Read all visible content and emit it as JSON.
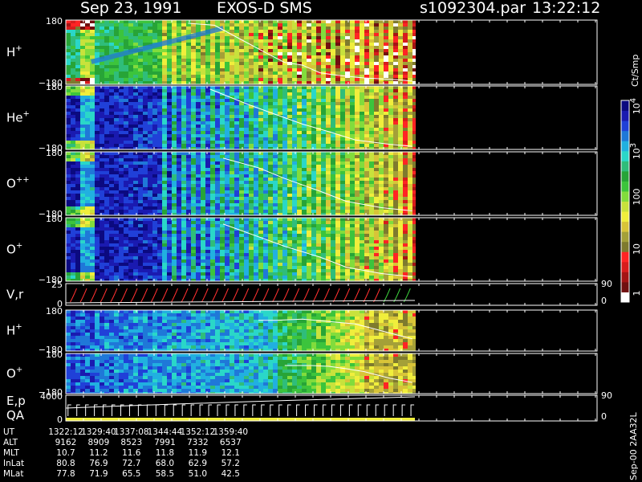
{
  "header": {
    "date": "Sep 23, 1991",
    "instrument": "EXOS-D SMS",
    "file": "s1092304.par",
    "time": "13:22:12"
  },
  "chart_data": {
    "type": "heatmap",
    "colorbar": {
      "title": "Ct/Smp",
      "labels": [
        "1",
        "10",
        "100",
        "10",
        "10"
      ],
      "label_sups": [
        "",
        "",
        "",
        "3",
        "4"
      ],
      "scale": "log",
      "range": [
        1,
        10000
      ],
      "colors": [
        "#0b0a80",
        "#1a1ab0",
        "#2040d8",
        "#1f78d8",
        "#21b0e0",
        "#2ad7c8",
        "#2fbd7a",
        "#27a437",
        "#3cc43c",
        "#82dc3c",
        "#c8e23c",
        "#f0ee3c",
        "#d8c438",
        "#a4a038",
        "#7e7a2e",
        "#ff2424",
        "#d81c1c",
        "#a41414",
        "#701010",
        "#ffffff"
      ]
    },
    "time_axis": {
      "range": [
        1322.2,
        1401.6
      ],
      "data_end": 1401.6
    },
    "panels": [
      {
        "id": "h-plus",
        "species": "H",
        "charge": "+",
        "ticks": [
          "180",
          "−180"
        ],
        "traj": [
          [
            1350,
            0.05
          ],
          [
            1356,
            0.08
          ],
          [
            1362,
            0.3
          ],
          [
            1368,
            0.52
          ],
          [
            1372,
            0.66
          ],
          [
            1376,
            0.7
          ],
          [
            1380,
            0.82
          ],
          [
            1384,
            0.86
          ],
          [
            1390,
            0.9
          ],
          [
            1398,
            0.93
          ],
          [
            1401,
            0.95
          ]
        ]
      },
      {
        "id": "he-plus",
        "species": "He",
        "charge": "+",
        "ticks": [
          "180",
          "−180"
        ],
        "traj": [
          [
            1355,
            0.05
          ],
          [
            1364,
            0.3
          ],
          [
            1370,
            0.45
          ],
          [
            1376,
            0.6
          ],
          [
            1382,
            0.72
          ],
          [
            1388,
            0.85
          ],
          [
            1396,
            0.92
          ],
          [
            1401,
            0.95
          ]
        ]
      },
      {
        "id": "o-plusplus",
        "species": "O",
        "charge": "++",
        "ticks": [
          "180",
          "−180"
        ],
        "traj": [
          [
            1358,
            0.1
          ],
          [
            1366,
            0.25
          ],
          [
            1372,
            0.42
          ],
          [
            1380,
            0.62
          ],
          [
            1386,
            0.78
          ],
          [
            1394,
            0.88
          ],
          [
            1401,
            0.93
          ]
        ]
      },
      {
        "id": "o-plus",
        "species": "O",
        "charge": "+",
        "ticks": [
          "180",
          "−180"
        ],
        "traj": [
          [
            1358,
            0.1
          ],
          [
            1366,
            0.3
          ],
          [
            1372,
            0.45
          ],
          [
            1380,
            0.62
          ],
          [
            1386,
            0.78
          ],
          [
            1394,
            0.88
          ],
          [
            1401,
            0.93
          ]
        ]
      },
      {
        "id": "vr",
        "species": "V,r",
        "charge": "",
        "ticks": [
          "25",
          "0"
        ],
        "right_ticks": [
          "90",
          "0"
        ]
      },
      {
        "id": "h-plus-2",
        "species": "H",
        "charge": "+",
        "ticks": [
          "180",
          "−180"
        ],
        "traj": [
          [
            1366,
            0.25
          ],
          [
            1370,
            0.25
          ],
          [
            1376,
            0.22
          ],
          [
            1380,
            0.26
          ],
          [
            1384,
            0.3
          ],
          [
            1388,
            0.34
          ],
          [
            1392,
            0.45
          ],
          [
            1398,
            0.62
          ],
          [
            1401,
            0.7
          ]
        ]
      },
      {
        "id": "o-plus-2",
        "species": "O",
        "charge": "+",
        "ticks": [
          "180",
          "−180"
        ],
        "traj": [
          [
            1372,
            0.3
          ],
          [
            1378,
            0.3
          ],
          [
            1382,
            0.32
          ],
          [
            1386,
            0.38
          ],
          [
            1390,
            0.45
          ],
          [
            1396,
            0.62
          ],
          [
            1401,
            0.72
          ]
        ]
      },
      {
        "id": "ep-qa",
        "species": "E,p",
        "species2": "QA",
        "ticks": [
          "4000",
          "0"
        ],
        "right_ticks": [
          "90",
          "0"
        ]
      }
    ],
    "annotations": [
      {
        "row": "UT",
        "values": [
          "1322:12",
          "1329:40",
          "1337:08",
          "1344:44",
          "1352:12",
          "1359:40"
        ]
      },
      {
        "row": "ALT",
        "values": [
          "9162",
          "8909",
          "8523",
          "7991",
          "7332",
          "6537"
        ]
      },
      {
        "row": "MLT",
        "values": [
          "10.7",
          "11.2",
          "11.6",
          "11.8",
          "11.9",
          "12.1"
        ]
      },
      {
        "row": "InLat",
        "values": [
          "80.8",
          "76.9",
          "72.7",
          "68.0",
          "62.9",
          "57.2"
        ]
      },
      {
        "row": "MLat",
        "values": [
          "77.8",
          "71.9",
          "65.5",
          "58.5",
          "51.0",
          "42.5"
        ]
      }
    ],
    "annotation_times": [
      1322.2,
      1329.67,
      1337.13,
      1344.73,
      1352.2,
      1359.67
    ],
    "footer": "Sep-00 2AA32L"
  }
}
